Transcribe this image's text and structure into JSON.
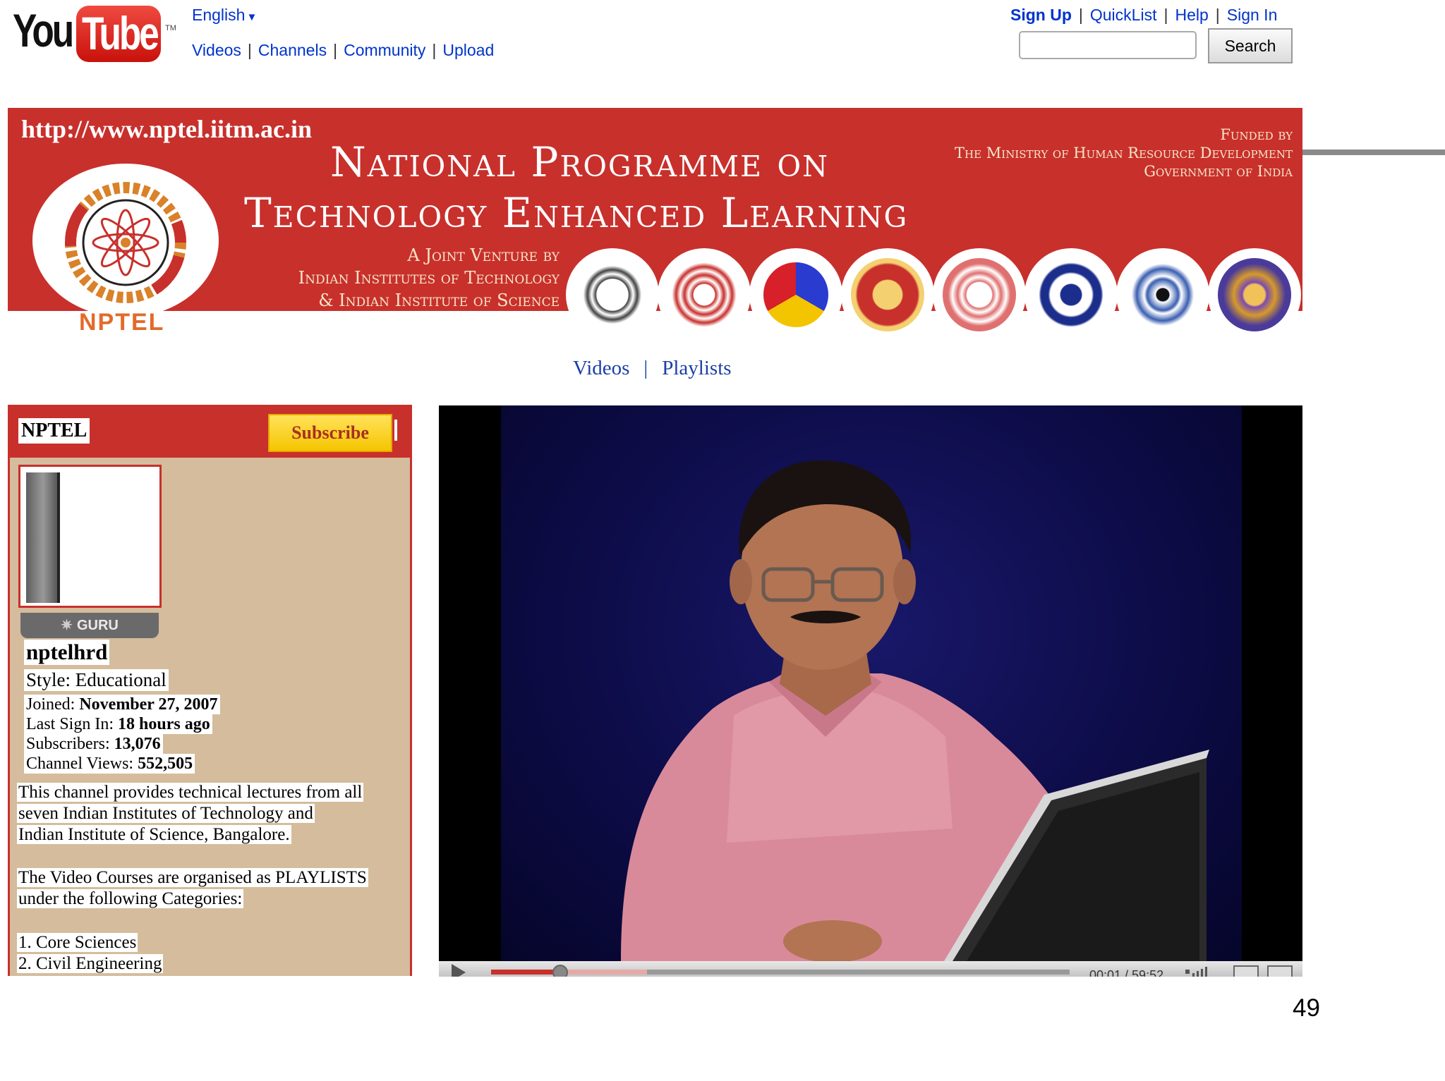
{
  "youtube": {
    "logo_you": "You",
    "logo_tube": "Tube",
    "logo_tm": "TM",
    "language": "English",
    "nav": [
      "Videos",
      "Channels",
      "Community",
      "Upload"
    ],
    "account_nav": [
      "Sign Up",
      "QuickList",
      "Help",
      "Sign In"
    ],
    "search_value": "",
    "search_button": "Search"
  },
  "banner": {
    "url": "http://www.nptel.iitm.ac.in",
    "title_line1": "National Programme on",
    "title_line2": "Technology Enhanced Learning",
    "funded_by": [
      "Funded by",
      "The Ministry of Human Resource Development",
      "Government of India"
    ],
    "joint_venture": [
      "A Joint Venture by",
      "Indian Institutes of Technology",
      "& Indian Institute of Science"
    ],
    "logo_text": "NPTEL",
    "colors": {
      "banner_red": "#c8302c",
      "text_cream": "#f7e6c8",
      "nptel_orange": "#e26b2b"
    }
  },
  "channel_nav": {
    "videos": "Videos",
    "playlists": "Playlists"
  },
  "profile": {
    "channel_name": "NPTEL",
    "subscribe": "Subscribe",
    "badge": "GURU",
    "username": "nptelhrd",
    "style": "Style: Educational",
    "joined_label": "Joined:",
    "joined_value": "November 27, 2007",
    "last_sign_in_label": "Last Sign In:",
    "last_sign_in_value": "18 hours ago",
    "subscribers_label": "Subscribers:",
    "subscribers_value": "13,076",
    "views_label": "Channel Views:",
    "views_value": "552,505",
    "description_lines": [
      "This channel provides technical lectures from all",
      "seven Indian Institutes of Technology and",
      "Indian Institute of Science, Bangalore."
    ],
    "playlist_lines": [
      "The Video Courses are organised as PLAYLISTS",
      "under the following Categories:"
    ],
    "categories": [
      "1. Core Sciences",
      "2. Civil Engineering"
    ]
  },
  "player": {
    "time": "00:01 / 59:52",
    "progress_fraction": 0.12,
    "buffered_fraction": 0.27
  },
  "slide_number": "49"
}
